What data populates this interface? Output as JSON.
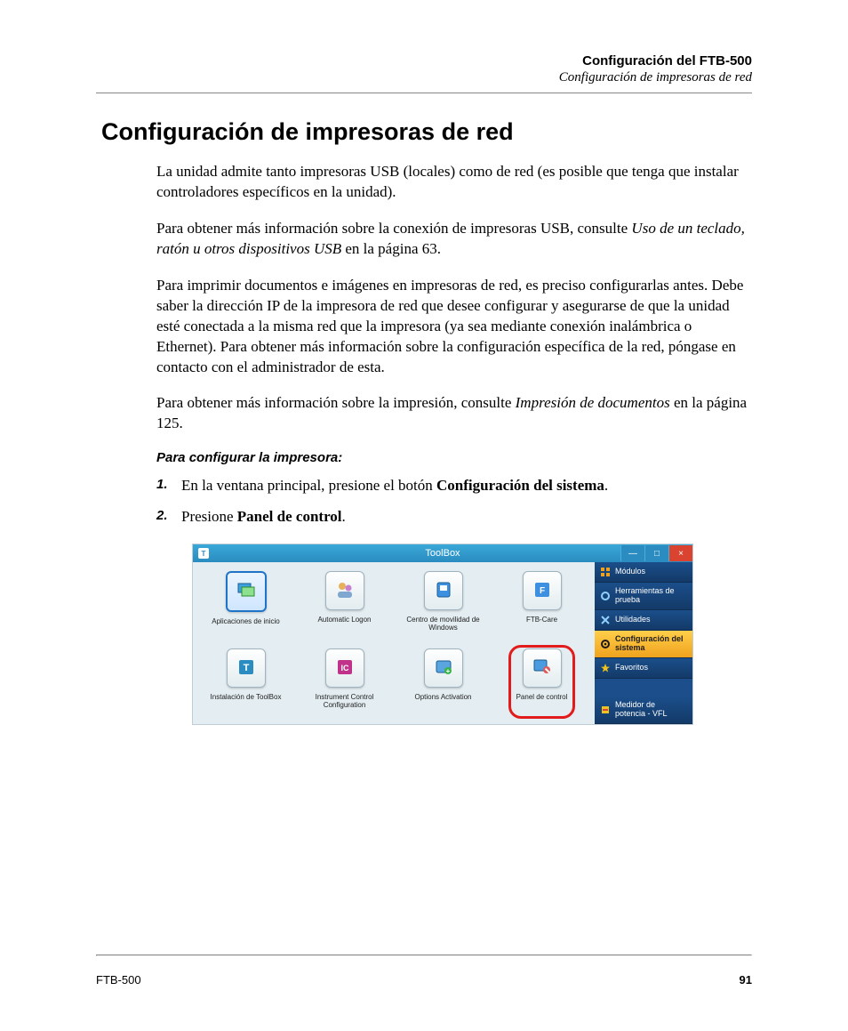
{
  "header": {
    "title": "Configuración del FTB-500",
    "subtitle": "Configuración de impresoras de red"
  },
  "h1": "Configuración de impresoras de red",
  "p1": "La unidad admite tanto impresoras USB (locales) como de red (es posible que tenga que instalar controladores específicos en la unidad).",
  "p2a": "Para obtener más información sobre la conexión de impresoras USB, consulte ",
  "p2i": "Uso de un teclado, ratón u otros dispositivos USB",
  "p2b": " en la página 63.",
  "p3": "Para imprimir documentos e imágenes en impresoras de red, es preciso configurarlas antes. Debe saber la dirección IP de la impresora de red que desee configurar y asegurarse de que la unidad esté conectada a la misma red que la impresora (ya sea mediante conexión inalámbrica o Ethernet). Para obtener más información sobre la configuración específica de la red, póngase en contacto con el administrador de esta.",
  "p4a": "Para obtener más información sobre la impresión, consulte ",
  "p4i": "Impresión de documentos",
  "p4b": " en la página 125.",
  "subhead": "Para configurar la impresora:",
  "step1": {
    "num": "1.",
    "a": "En la ventana principal, presione el botón ",
    "b": "Configuración del sistema",
    "c": "."
  },
  "step2": {
    "num": "2.",
    "a": "Presione ",
    "b": "Panel de control",
    "c": "."
  },
  "shot": {
    "title": "ToolBox",
    "tb_letter": "T",
    "min": "—",
    "max": "□",
    "close": "×",
    "grid": [
      "Aplicaciones de inicio",
      "Automatic Logon",
      "Centro de movilidad de Windows",
      "FTB-Care",
      "Instalación de ToolBox",
      "Instrument Control Configuration",
      "Options Activation",
      "Panel de control"
    ],
    "side": [
      "Módulos",
      "Herramientas de prueba",
      "Utilidades",
      "Configuración del sistema",
      "Favoritos",
      "Medidor de potencia - VFL"
    ]
  },
  "footer": {
    "left": "FTB-500",
    "right": "91"
  }
}
